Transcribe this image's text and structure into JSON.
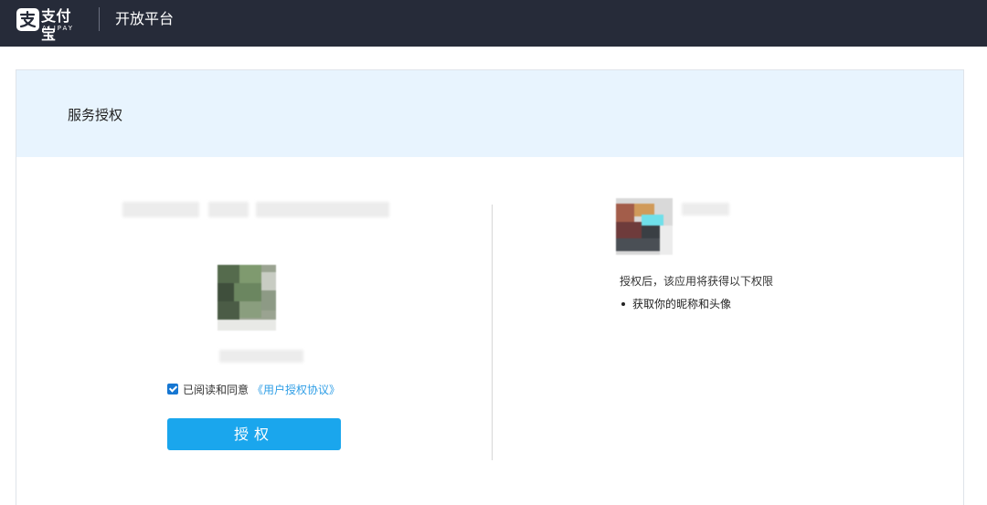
{
  "header": {
    "logo_cn": "支付宝",
    "logo_en": "ALIPAY",
    "platform_title": "开放平台"
  },
  "card": {
    "title": "服务授权"
  },
  "agreement": {
    "checked": true,
    "text": "已阅读和同意",
    "link_label": "《用户授权协议》"
  },
  "auth_button": {
    "label": "授权"
  },
  "permissions": {
    "title": "授权后，该应用将获得以下权限",
    "items": [
      "获取你的昵称和头像"
    ]
  },
  "colors": {
    "topbar": "#262b39",
    "header_band": "#e8f4fe",
    "button": "#1aa6ed",
    "link": "#2f9ee6",
    "checkbox": "#1677d2"
  }
}
